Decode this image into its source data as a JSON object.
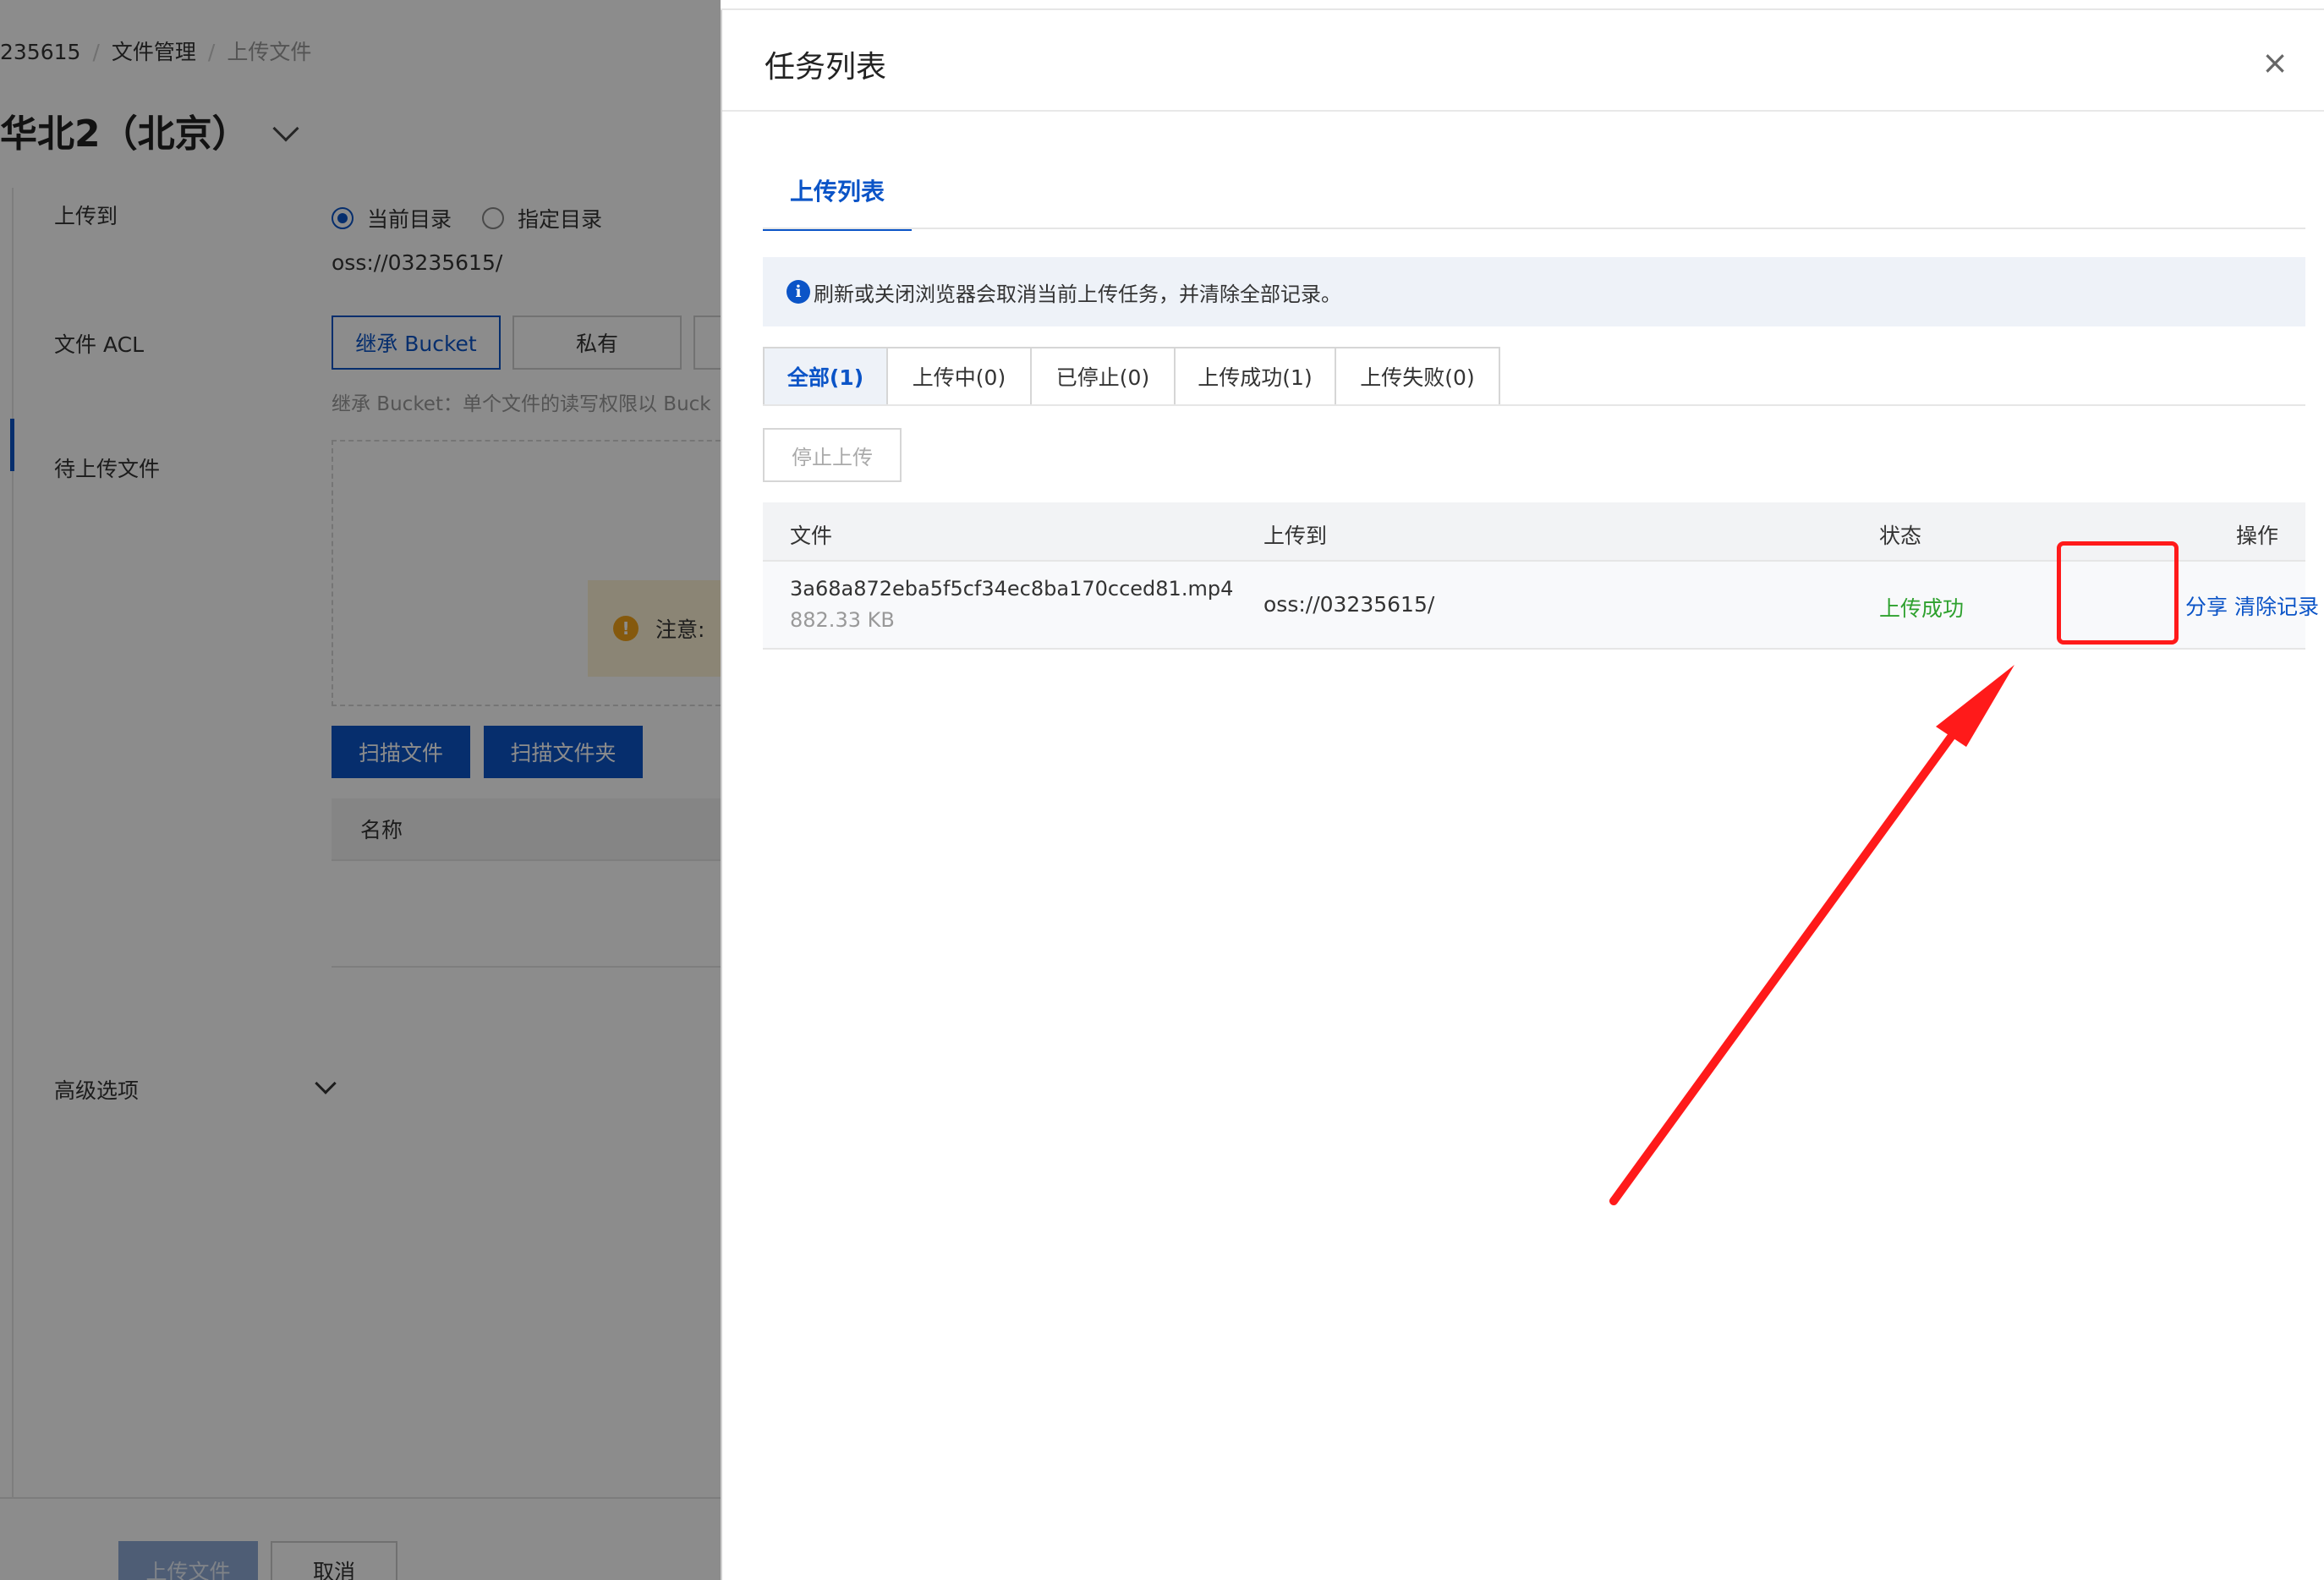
{
  "background_page": {
    "breadcrumb": {
      "item1": "235615",
      "item2": "文件管理",
      "current": "上传文件"
    },
    "region": {
      "title": "华北2（北京）"
    },
    "form": {
      "upload_to_label": "上传到",
      "radio_current": "当前目录",
      "radio_specified": "指定目录",
      "oss_path": "oss://03235615/",
      "acl_label": "文件 ACL",
      "acl_inherit": "继承 Bucket",
      "acl_private": "私有",
      "acl_hint": "继承 Bucket：单个文件的读写权限以 Buck",
      "pending_label": "待上传文件",
      "notice_text": "注意:",
      "scan_files": "扫描文件",
      "scan_folder": "扫描文件夹",
      "name_column": "名称",
      "advanced_label": "高级选项"
    },
    "footer": {
      "upload_button": "上传文件",
      "cancel_button": "取消"
    }
  },
  "drawer": {
    "title": "任务列表",
    "close_icon": "close-icon",
    "tab_label": "上传列表",
    "info_text": "刷新或关闭浏览器会取消当前上传任务，并清除全部记录。",
    "filter_tabs": [
      "全部(1)",
      "上传中(0)",
      "已停止(0)",
      "上传成功(1)",
      "上传失败(0)"
    ],
    "active_filter": "全部(1)",
    "stop_button": "停止上传",
    "table": {
      "headers": {
        "file": "文件",
        "dest": "上传到",
        "status": "状态",
        "actions": "操作"
      },
      "rows": [
        {
          "file_name": "3a68a872eba5f5cf34ec8ba170cced81.mp4",
          "file_size": "882.33 KB",
          "dest": "oss://03235615/",
          "status": "上传成功",
          "action_share": "分享",
          "action_clear": "清除记录"
        }
      ]
    }
  },
  "colors": {
    "primary": "#0b54c7",
    "success": "#2ea12e",
    "annotation": "#ff1a1a"
  }
}
